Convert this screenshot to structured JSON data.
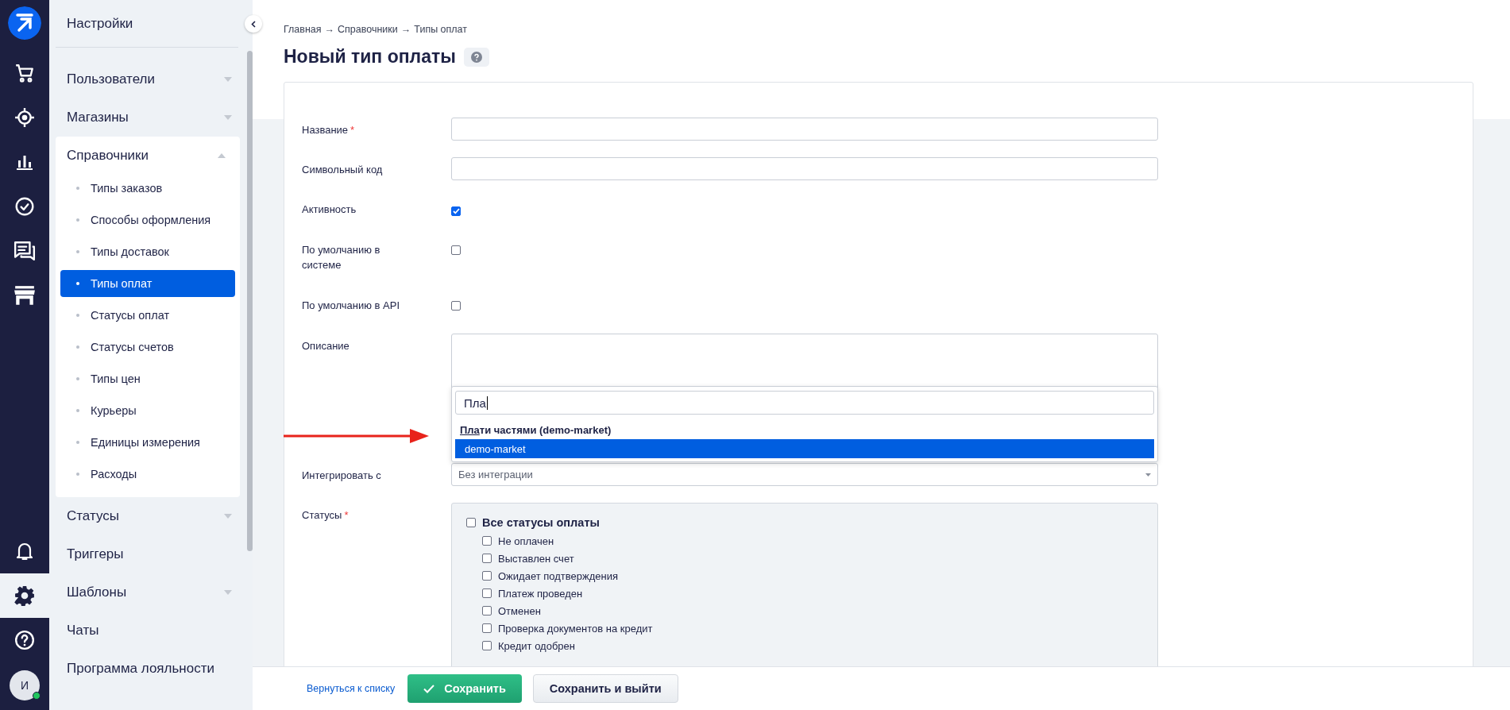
{
  "rail": {
    "top": [
      {
        "kind": "cart",
        "selected": false
      },
      {
        "kind": "target",
        "selected": false
      },
      {
        "kind": "chart",
        "selected": false
      },
      {
        "kind": "check",
        "selected": false
      },
      {
        "kind": "chat",
        "selected": false
      },
      {
        "kind": "store",
        "selected": false
      }
    ],
    "bottom": [
      {
        "kind": "bell",
        "selected": false
      },
      {
        "kind": "gear",
        "selected": true
      },
      {
        "kind": "help",
        "selected": false
      }
    ],
    "avatar": {
      "initial": "И",
      "online": true
    }
  },
  "sidebar": {
    "title": "Настройки",
    "items": [
      {
        "label": "Пользователи",
        "kind": "group",
        "expanded": false
      },
      {
        "label": "Магазины",
        "kind": "group",
        "expanded": false
      },
      {
        "label": "Справочники",
        "kind": "group",
        "expanded": true,
        "children": [
          {
            "label": "Типы заказов",
            "selected": false
          },
          {
            "label": "Способы оформления",
            "selected": false
          },
          {
            "label": "Типы доставок",
            "selected": false
          },
          {
            "label": "Типы оплат",
            "selected": true
          },
          {
            "label": "Статусы оплат",
            "selected": false
          },
          {
            "label": "Статусы счетов",
            "selected": false
          },
          {
            "label": "Типы цен",
            "selected": false
          },
          {
            "label": "Курьеры",
            "selected": false
          },
          {
            "label": "Единицы измерения",
            "selected": false
          },
          {
            "label": "Расходы",
            "selected": false
          }
        ]
      },
      {
        "label": "Статусы",
        "kind": "group",
        "expanded": false
      },
      {
        "label": "Триггеры",
        "kind": "link"
      },
      {
        "label": "Шаблоны",
        "kind": "group",
        "expanded": false
      },
      {
        "label": "Чаты",
        "kind": "link"
      },
      {
        "label": "Программа лояльности",
        "kind": "link"
      }
    ]
  },
  "breadcrumb": [
    "Главная",
    "→",
    "Справочники",
    "→",
    "Типы оплат"
  ],
  "page_title": "Новый тип оплаты",
  "form": {
    "fields": [
      {
        "label": "Название",
        "kind": "text",
        "required_mark": "*"
      },
      {
        "label": "Символьный код",
        "kind": "text"
      },
      {
        "label": "Активность",
        "kind": "checkbox",
        "checked": true
      },
      {
        "label": "По умолчанию в системе",
        "kind": "checkbox",
        "checked": false
      },
      {
        "label": "По умолчанию в API",
        "kind": "checkbox",
        "checked": false
      },
      {
        "label": "Описание",
        "kind": "textarea",
        "dropdown": {
          "search": "Пла",
          "groups": [
            {
              "label": "Плати частями (demo-market)",
              "options": [
                {
                  "label": "demo-market",
                  "selected": true
                }
              ]
            }
          ]
        }
      },
      {
        "label": "Интегрировать с",
        "kind": "select",
        "value": "Без интеграции"
      },
      {
        "label": "Статусы",
        "kind": "statuses",
        "required_mark": "*",
        "all": {
          "label": "Все статусы оплаты",
          "checked": false
        },
        "items": [
          {
            "label": "Не оплачен",
            "checked": false
          },
          {
            "label": "Выставлен счет",
            "checked": false
          },
          {
            "label": "Ожидает подтверждения",
            "checked": false
          },
          {
            "label": "Платеж проведен",
            "checked": false
          },
          {
            "label": "Отменен",
            "checked": false
          },
          {
            "label": "Проверка документов на кредит",
            "checked": false
          },
          {
            "label": "Кредит одобрен",
            "checked": false
          }
        ]
      }
    ]
  },
  "footer": {
    "back_link": "Вернуться к списку",
    "save": "Сохранить",
    "save_exit": "Сохранить и выйти"
  }
}
